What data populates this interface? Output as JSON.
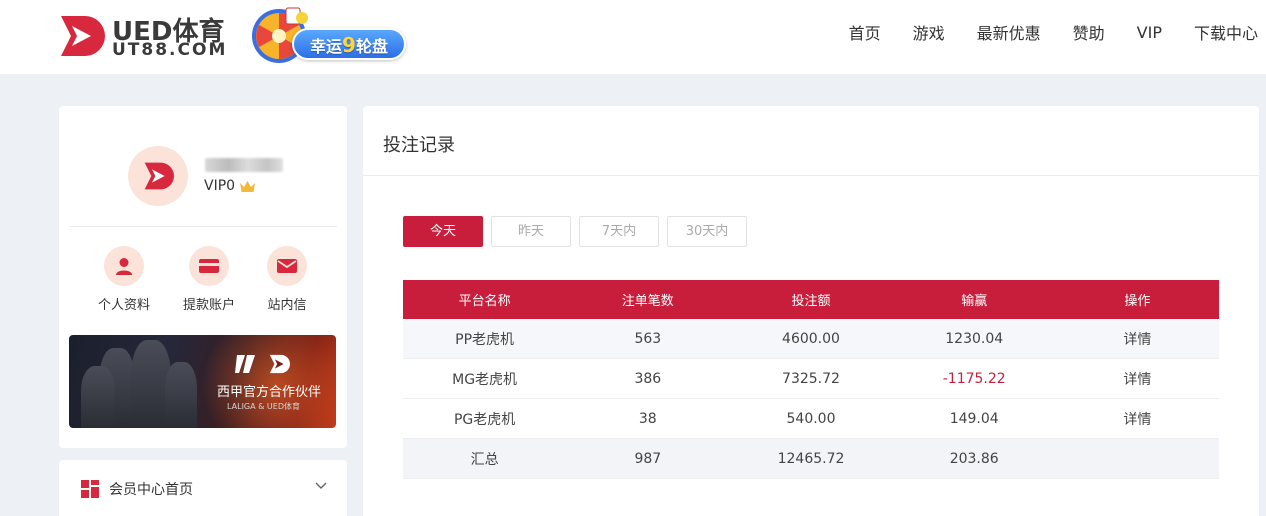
{
  "header": {
    "logo_title": "UED体育",
    "logo_sub": "UT88.COM",
    "promo": {
      "text_prefix": "幸运",
      "number": "9",
      "text_suffix": "轮盘"
    },
    "nav": [
      "首页",
      "游戏",
      "最新优惠",
      "赞助",
      "VIP",
      "下载中心"
    ]
  },
  "profile": {
    "vip_level": "VIP0",
    "quick_links": [
      "个人资料",
      "提款账户",
      "站内信"
    ],
    "banner": {
      "title": "西甲官方合作伙伴",
      "subtitle": "LALIGA & UED体育"
    }
  },
  "menu": {
    "item": "会员中心首页"
  },
  "main": {
    "title": "投注记录",
    "tabs": [
      "今天",
      "昨天",
      "7天内",
      "30天内"
    ],
    "active_tab": "今天",
    "table": {
      "headers": [
        "平台名称",
        "注单笔数",
        "投注额",
        "输赢",
        "操作"
      ],
      "rows": [
        {
          "platform": "PP老虎机",
          "count": "563",
          "amount": "4600.00",
          "win_loss": "1230.04",
          "action": "详情"
        },
        {
          "platform": "MG老虎机",
          "count": "386",
          "amount": "7325.72",
          "win_loss": "-1175.22",
          "action": "详情"
        },
        {
          "platform": "PG老虎机",
          "count": "38",
          "amount": "540.00",
          "win_loss": "149.04",
          "action": "详情"
        }
      ],
      "total": {
        "label": "汇总",
        "count": "987",
        "amount": "12465.72",
        "win_loss": "203.86"
      }
    }
  },
  "colors": {
    "brand": "#c81e3c",
    "negative": "#c81e3c",
    "icon_bg": "#fbe3da"
  }
}
